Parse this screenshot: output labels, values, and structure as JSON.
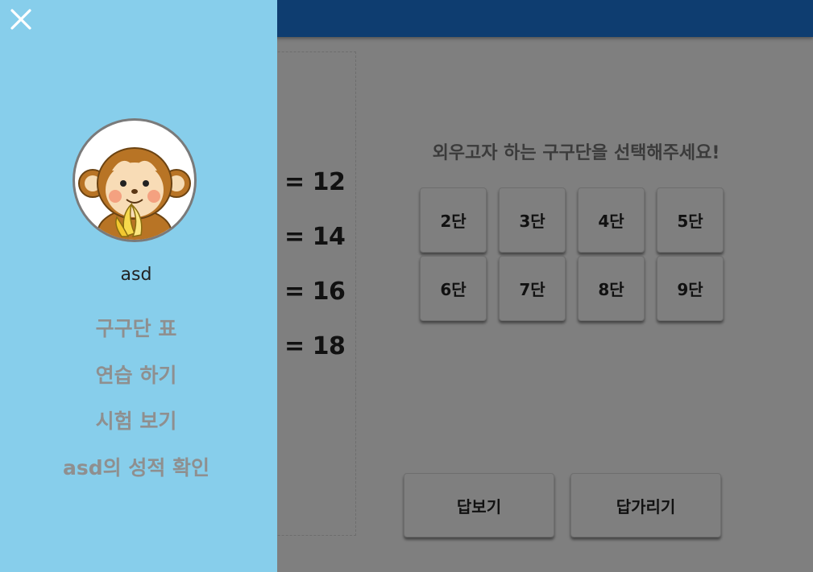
{
  "drawer": {
    "close_icon": "close-icon",
    "avatar_icon": "monkey-with-banana-avatar",
    "username": "asd",
    "menu": [
      {
        "label": "구구단 표"
      },
      {
        "label": "연습 하기"
      },
      {
        "label": "시험 보기"
      },
      {
        "label": "asd의 성적 확인"
      }
    ],
    "background_color": "#87ceeb"
  },
  "header": {
    "background_color": "#0e3d70"
  },
  "times_table": {
    "rows": [
      "= 12",
      "= 14",
      "= 16",
      "= 18"
    ]
  },
  "main": {
    "prompt": "외우고자 하는 구구단을 선택해주세요!",
    "dan_buttons": [
      "2단",
      "3단",
      "4단",
      "5단",
      "6단",
      "7단",
      "8단",
      "9단"
    ],
    "show_answer_label": "답보기",
    "hide_answer_label": "답가리기"
  }
}
